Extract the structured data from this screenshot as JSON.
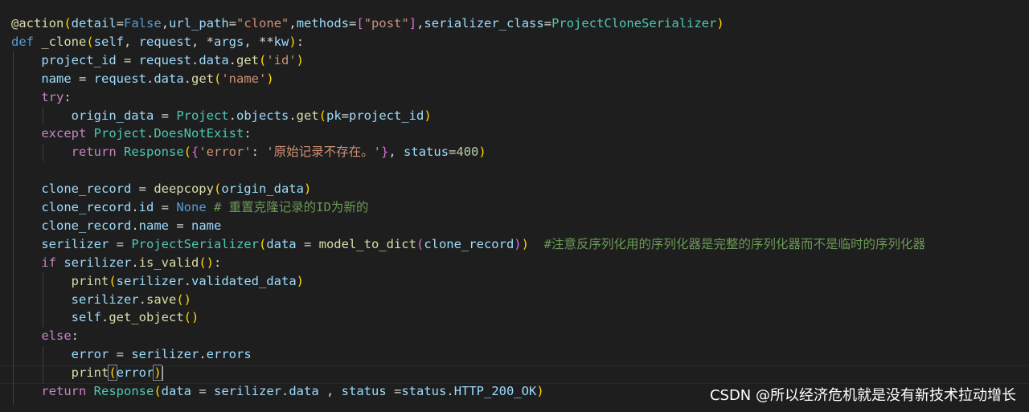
{
  "colors": {
    "background": "#1e1e1e",
    "keyword": "#569cd6",
    "control": "#c586c0",
    "function": "#dcdcaa",
    "variable": "#9cdcfe",
    "class": "#4ec9b0",
    "string": "#ce9178",
    "number": "#b5cea8",
    "comment": "#6a9955"
  },
  "watermark": "CSDN @所以经济危机就是没有新技术拉动增长",
  "code": [
    [
      [
        "decorator",
        "@action"
      ],
      [
        "bracket-y",
        "("
      ],
      [
        "param",
        "detail"
      ],
      [
        "punct",
        "="
      ],
      [
        "bool",
        "False"
      ],
      [
        "punct",
        ","
      ],
      [
        "param",
        "url_path"
      ],
      [
        "punct",
        "="
      ],
      [
        "string",
        "\"clone\""
      ],
      [
        "punct",
        ","
      ],
      [
        "param",
        "methods"
      ],
      [
        "punct",
        "="
      ],
      [
        "bracket-p",
        "["
      ],
      [
        "string",
        "\"post\""
      ],
      [
        "bracket-p",
        "]"
      ],
      [
        "punct",
        ","
      ],
      [
        "param",
        "serializer_class"
      ],
      [
        "punct",
        "="
      ],
      [
        "class",
        "ProjectCloneSerializer"
      ],
      [
        "bracket-y",
        ")"
      ]
    ],
    [
      [
        "keyword",
        "def"
      ],
      [
        "punct",
        " "
      ],
      [
        "function",
        "_clone"
      ],
      [
        "bracket-y",
        "("
      ],
      [
        "param",
        "self"
      ],
      [
        "punct",
        ", "
      ],
      [
        "param",
        "request"
      ],
      [
        "punct",
        ", *"
      ],
      [
        "param",
        "args"
      ],
      [
        "punct",
        ", **"
      ],
      [
        "param",
        "kw"
      ],
      [
        "bracket-y",
        ")"
      ],
      [
        "punct",
        ":"
      ]
    ],
    [
      [
        "punct",
        "    "
      ],
      [
        "variable",
        "project_id"
      ],
      [
        "punct",
        " = "
      ],
      [
        "variable",
        "request"
      ],
      [
        "punct",
        "."
      ],
      [
        "variable",
        "data"
      ],
      [
        "punct",
        "."
      ],
      [
        "function",
        "get"
      ],
      [
        "bracket-y",
        "("
      ],
      [
        "string",
        "'id'"
      ],
      [
        "bracket-y",
        ")"
      ]
    ],
    [
      [
        "punct",
        "    "
      ],
      [
        "variable",
        "name"
      ],
      [
        "punct",
        " = "
      ],
      [
        "variable",
        "request"
      ],
      [
        "punct",
        "."
      ],
      [
        "variable",
        "data"
      ],
      [
        "punct",
        "."
      ],
      [
        "function",
        "get"
      ],
      [
        "bracket-y",
        "("
      ],
      [
        "string",
        "'name'"
      ],
      [
        "bracket-y",
        ")"
      ]
    ],
    [
      [
        "punct",
        "    "
      ],
      [
        "control",
        "try"
      ],
      [
        "punct",
        ":"
      ]
    ],
    [
      [
        "punct",
        "        "
      ],
      [
        "variable",
        "origin_data"
      ],
      [
        "punct",
        " = "
      ],
      [
        "class",
        "Project"
      ],
      [
        "punct",
        "."
      ],
      [
        "variable",
        "objects"
      ],
      [
        "punct",
        "."
      ],
      [
        "function",
        "get"
      ],
      [
        "bracket-y",
        "("
      ],
      [
        "param",
        "pk"
      ],
      [
        "punct",
        "="
      ],
      [
        "variable",
        "project_id"
      ],
      [
        "bracket-y",
        ")"
      ]
    ],
    [
      [
        "punct",
        "    "
      ],
      [
        "control",
        "except"
      ],
      [
        "punct",
        " "
      ],
      [
        "class",
        "Project"
      ],
      [
        "punct",
        "."
      ],
      [
        "class",
        "DoesNotExist"
      ],
      [
        "punct",
        ":"
      ]
    ],
    [
      [
        "punct",
        "        "
      ],
      [
        "control",
        "return"
      ],
      [
        "punct",
        " "
      ],
      [
        "class",
        "Response"
      ],
      [
        "bracket-y",
        "("
      ],
      [
        "bracket-p",
        "{"
      ],
      [
        "string",
        "'error'"
      ],
      [
        "punct",
        ": "
      ],
      [
        "string",
        "'原始记录不存在。'"
      ],
      [
        "bracket-p",
        "}"
      ],
      [
        "punct",
        ", "
      ],
      [
        "param",
        "status"
      ],
      [
        "punct",
        "="
      ],
      [
        "number",
        "400"
      ],
      [
        "bracket-y",
        ")"
      ]
    ],
    [],
    [
      [
        "punct",
        "    "
      ],
      [
        "variable",
        "clone_record"
      ],
      [
        "punct",
        " = "
      ],
      [
        "function",
        "deepcopy"
      ],
      [
        "bracket-y",
        "("
      ],
      [
        "variable",
        "origin_data"
      ],
      [
        "bracket-y",
        ")"
      ]
    ],
    [
      [
        "punct",
        "    "
      ],
      [
        "variable",
        "clone_record"
      ],
      [
        "punct",
        "."
      ],
      [
        "variable",
        "id"
      ],
      [
        "punct",
        " = "
      ],
      [
        "keyword",
        "None"
      ],
      [
        "punct",
        " "
      ],
      [
        "comment",
        "# 重置克隆记录的ID为新的"
      ]
    ],
    [
      [
        "punct",
        "    "
      ],
      [
        "variable",
        "clone_record"
      ],
      [
        "punct",
        "."
      ],
      [
        "variable",
        "name"
      ],
      [
        "punct",
        " = "
      ],
      [
        "variable",
        "name"
      ]
    ],
    [
      [
        "punct",
        "    "
      ],
      [
        "variable",
        "serilizer"
      ],
      [
        "punct",
        " = "
      ],
      [
        "class",
        "ProjectSerializer"
      ],
      [
        "bracket-y",
        "("
      ],
      [
        "param",
        "data"
      ],
      [
        "punct",
        " = "
      ],
      [
        "function",
        "model_to_dict"
      ],
      [
        "bracket-p",
        "("
      ],
      [
        "variable",
        "clone_record"
      ],
      [
        "bracket-p",
        ")"
      ],
      [
        "bracket-y",
        ")"
      ],
      [
        "punct",
        "  "
      ],
      [
        "comment",
        "#注意反序列化用的序列化器是完整的序列化器而不是临时的序列化器"
      ]
    ],
    [
      [
        "punct",
        "    "
      ],
      [
        "control",
        "if"
      ],
      [
        "punct",
        " "
      ],
      [
        "variable",
        "serilizer"
      ],
      [
        "punct",
        "."
      ],
      [
        "function",
        "is_valid"
      ],
      [
        "bracket-y",
        "()"
      ],
      [
        "punct",
        ":"
      ]
    ],
    [
      [
        "punct",
        "        "
      ],
      [
        "function",
        "print"
      ],
      [
        "bracket-y",
        "("
      ],
      [
        "variable",
        "serilizer"
      ],
      [
        "punct",
        "."
      ],
      [
        "variable",
        "validated_data"
      ],
      [
        "bracket-y",
        ")"
      ]
    ],
    [
      [
        "punct",
        "        "
      ],
      [
        "variable",
        "serilizer"
      ],
      [
        "punct",
        "."
      ],
      [
        "function",
        "save"
      ],
      [
        "bracket-y",
        "()"
      ]
    ],
    [
      [
        "punct",
        "        "
      ],
      [
        "variable",
        "self"
      ],
      [
        "punct",
        "."
      ],
      [
        "function",
        "get_object"
      ],
      [
        "bracket-y",
        "()"
      ]
    ],
    [
      [
        "punct",
        "    "
      ],
      [
        "control",
        "else"
      ],
      [
        "punct",
        ":"
      ]
    ],
    [
      [
        "punct",
        "        "
      ],
      [
        "variable",
        "error"
      ],
      [
        "punct",
        " = "
      ],
      [
        "variable",
        "serilizer"
      ],
      [
        "punct",
        "."
      ],
      [
        "variable",
        "errors"
      ]
    ],
    [
      [
        "punct",
        "        "
      ],
      [
        "function",
        "print"
      ],
      [
        "bracket-match",
        "("
      ],
      [
        "variable",
        "error"
      ],
      [
        "bracket-match",
        ")"
      ],
      [
        "cursor",
        ""
      ]
    ],
    [
      [
        "punct",
        "    "
      ],
      [
        "control",
        "return"
      ],
      [
        "punct",
        " "
      ],
      [
        "class",
        "Response"
      ],
      [
        "bracket-y",
        "("
      ],
      [
        "param",
        "data"
      ],
      [
        "punct",
        " = "
      ],
      [
        "variable",
        "serilizer"
      ],
      [
        "punct",
        "."
      ],
      [
        "variable",
        "data"
      ],
      [
        "punct",
        " , "
      ],
      [
        "param",
        "status"
      ],
      [
        "punct",
        " ="
      ],
      [
        "variable",
        "status"
      ],
      [
        "punct",
        "."
      ],
      [
        "variable",
        "HTTP_200_OK"
      ],
      [
        "bracket-y",
        ")"
      ]
    ]
  ]
}
